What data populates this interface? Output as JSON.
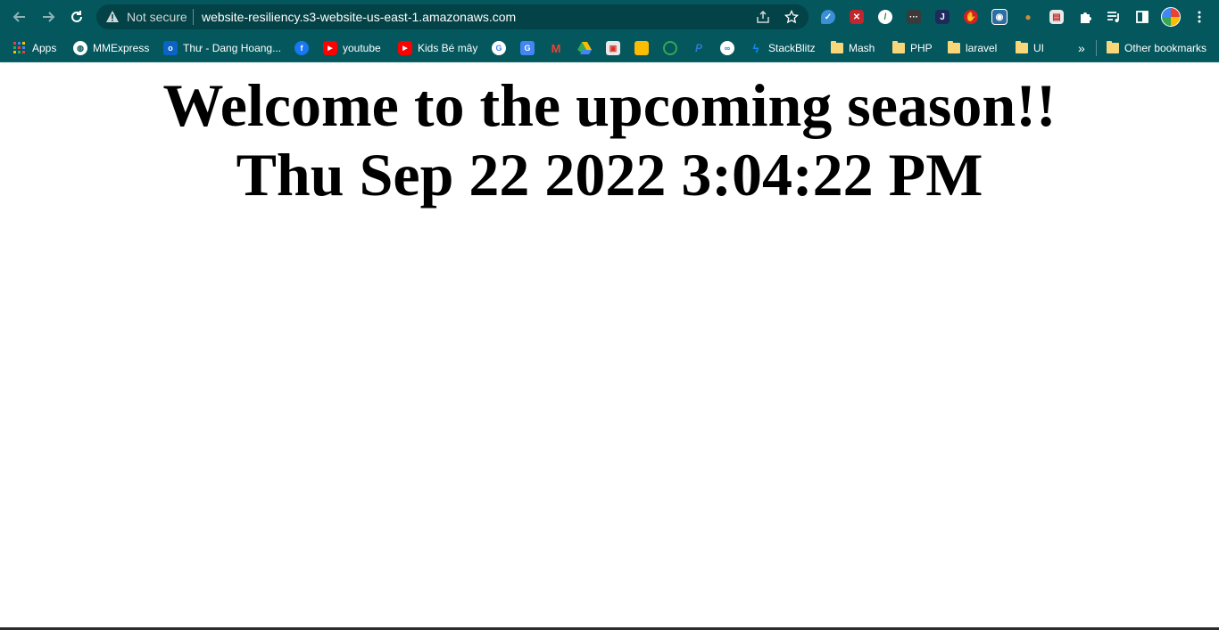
{
  "browser": {
    "security_label": "Not secure",
    "url": "website-resiliency.s3-website-us-east-1.amazonaws.com",
    "toolbar_color": "#04575d",
    "nav_icons": [
      "back-arrow-icon",
      "forward-arrow-icon",
      "reload-icon"
    ],
    "omnibox_icons": [
      "share-icon",
      "star-icon"
    ],
    "extensions": [
      "shield-extension-icon",
      "tools-extension-icon",
      "color-wheel-extension-icon",
      "dots-extension-icon",
      "j-extension-icon",
      "hand-extension-icon",
      "capture-extension-icon",
      "cookie-extension-icon",
      "print-extension-icon",
      "puzzle-icon",
      "media-control-icon",
      "side-panel-icon",
      "profile-avatar-icon",
      "more-menu-icon"
    ]
  },
  "bookmarks": {
    "items": [
      {
        "label": "Apps",
        "icon": "apps-grid-icon"
      },
      {
        "label": "MMExpress",
        "icon": "globe-icon"
      },
      {
        "label": "Thư - Dang Hoang...",
        "icon": "outlook-icon"
      },
      {
        "label": "",
        "icon": "facebook-icon"
      },
      {
        "label": "youtube",
        "icon": "youtube-icon"
      },
      {
        "label": "Kids Bé mây",
        "icon": "youtube-icon"
      },
      {
        "label": "",
        "icon": "google-icon"
      },
      {
        "label": "",
        "icon": "google-translate-icon"
      },
      {
        "label": "",
        "icon": "gmail-icon"
      },
      {
        "label": "",
        "icon": "google-drive-icon"
      },
      {
        "label": "",
        "icon": "calendar-icon"
      },
      {
        "label": "",
        "icon": "keep-icon"
      },
      {
        "label": "",
        "icon": "circle-icon"
      },
      {
        "label": "",
        "icon": "paypal-icon"
      },
      {
        "label": "",
        "icon": "link-icon"
      },
      {
        "label": "StackBlitz",
        "icon": "stackblitz-icon"
      },
      {
        "label": "Mash",
        "icon": "folder-icon"
      },
      {
        "label": "PHP",
        "icon": "folder-icon"
      },
      {
        "label": "laravel",
        "icon": "folder-icon"
      },
      {
        "label": "UI",
        "icon": "folder-icon"
      }
    ],
    "overflow_label": "»",
    "other_label": "Other bookmarks"
  },
  "page": {
    "heading": "Welcome to the upcoming season!!",
    "datetime": "Thu Sep 22 2022 3:04:22 PM"
  }
}
